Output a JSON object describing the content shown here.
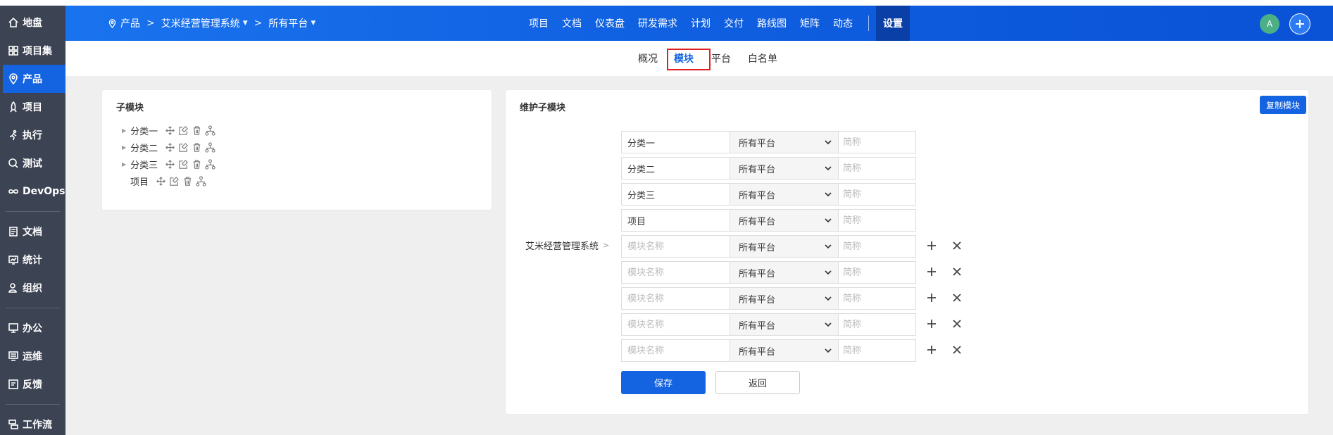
{
  "sidebar": {
    "items": [
      {
        "label": "地盘",
        "icon": "home-icon",
        "active": false
      },
      {
        "label": "项目集",
        "icon": "grid-icon",
        "active": false
      },
      {
        "label": "产品",
        "icon": "location-icon",
        "active": true
      },
      {
        "label": "项目",
        "icon": "rocket-icon",
        "active": false
      },
      {
        "label": "执行",
        "icon": "run-icon",
        "active": false
      },
      {
        "label": "测试",
        "icon": "search-icon",
        "active": false
      },
      {
        "label": "DevOps",
        "icon": "infinity-icon",
        "active": false
      },
      {
        "label": "文档",
        "icon": "doc-icon",
        "active": false
      },
      {
        "label": "统计",
        "icon": "chart-icon",
        "active": false
      },
      {
        "label": "组织",
        "icon": "people-icon",
        "active": false
      },
      {
        "label": "办公",
        "icon": "monitor-icon",
        "active": false
      },
      {
        "label": "运维",
        "icon": "server-icon",
        "active": false
      },
      {
        "label": "反馈",
        "icon": "feedback-icon",
        "active": false
      },
      {
        "label": "工作流",
        "icon": "workflow-icon",
        "active": false
      }
    ]
  },
  "header": {
    "breadcrumb": {
      "product": "产品",
      "system": "艾米经营管理系统",
      "platform": "所有平台"
    },
    "nav": [
      "项目",
      "文档",
      "仪表盘",
      "研发需求",
      "计划",
      "交付",
      "路线图",
      "矩阵",
      "动态"
    ],
    "settings": "设置",
    "avatar": "A"
  },
  "subnav": {
    "overview": "概况",
    "modules": "模块",
    "platform": "平台",
    "whitelist": "白名单"
  },
  "left_panel": {
    "title": "子模块",
    "tree": [
      {
        "label": "分类一",
        "expandable": true
      },
      {
        "label": "分类二",
        "expandable": true
      },
      {
        "label": "分类三",
        "expandable": true
      },
      {
        "label": "项目",
        "expandable": false
      }
    ]
  },
  "right_panel": {
    "title": "维护子模块",
    "copy_label": "复制模块",
    "parent": "艾米经营管理系统",
    "name_placeholder": "模块名称",
    "short_placeholder": "简称",
    "platform_value": "所有平台",
    "rows": [
      {
        "name": "分类一"
      },
      {
        "name": "分类二"
      },
      {
        "name": "分类三"
      },
      {
        "name": "项目"
      },
      {
        "name": ""
      },
      {
        "name": ""
      },
      {
        "name": ""
      },
      {
        "name": ""
      },
      {
        "name": ""
      }
    ],
    "save_label": "保存",
    "back_label": "返回"
  }
}
